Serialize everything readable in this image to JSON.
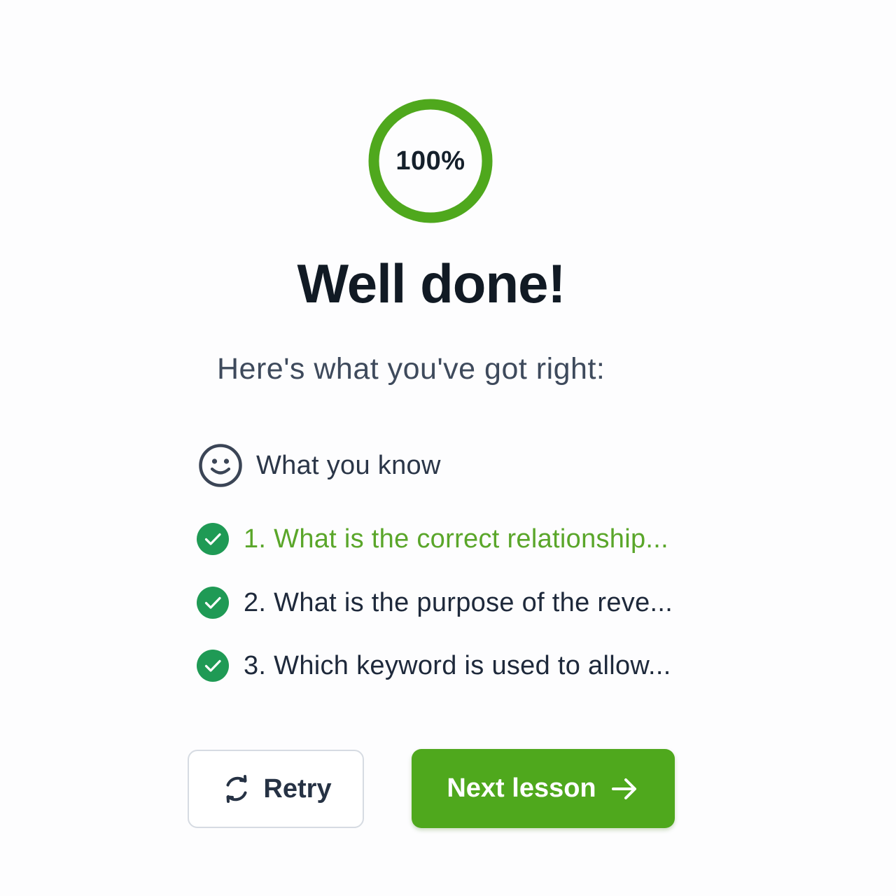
{
  "score": {
    "label": "100%",
    "value": 1.0,
    "color": "#4fa81d"
  },
  "title": "Well done!",
  "subtitle": "Here's what you've got right:",
  "section": {
    "label": "What you know",
    "icon": "smiley-icon"
  },
  "questions": [
    {
      "label": "1. What is the correct relationship...",
      "status": "correct",
      "highlighted": true
    },
    {
      "label": "2. What is the purpose of the reve...",
      "status": "correct",
      "highlighted": false
    },
    {
      "label": "3. Which keyword is used to allow...",
      "status": "correct",
      "highlighted": false
    }
  ],
  "buttons": {
    "retry": {
      "label": "Retry",
      "icon": "refresh-icon"
    },
    "next": {
      "label": "Next lesson",
      "icon": "arrow-right-icon"
    }
  },
  "colors": {
    "accent": "#4fa81d",
    "check": "#1f9a55",
    "highlight_text": "#5aa62a",
    "heading": "#111a24"
  }
}
